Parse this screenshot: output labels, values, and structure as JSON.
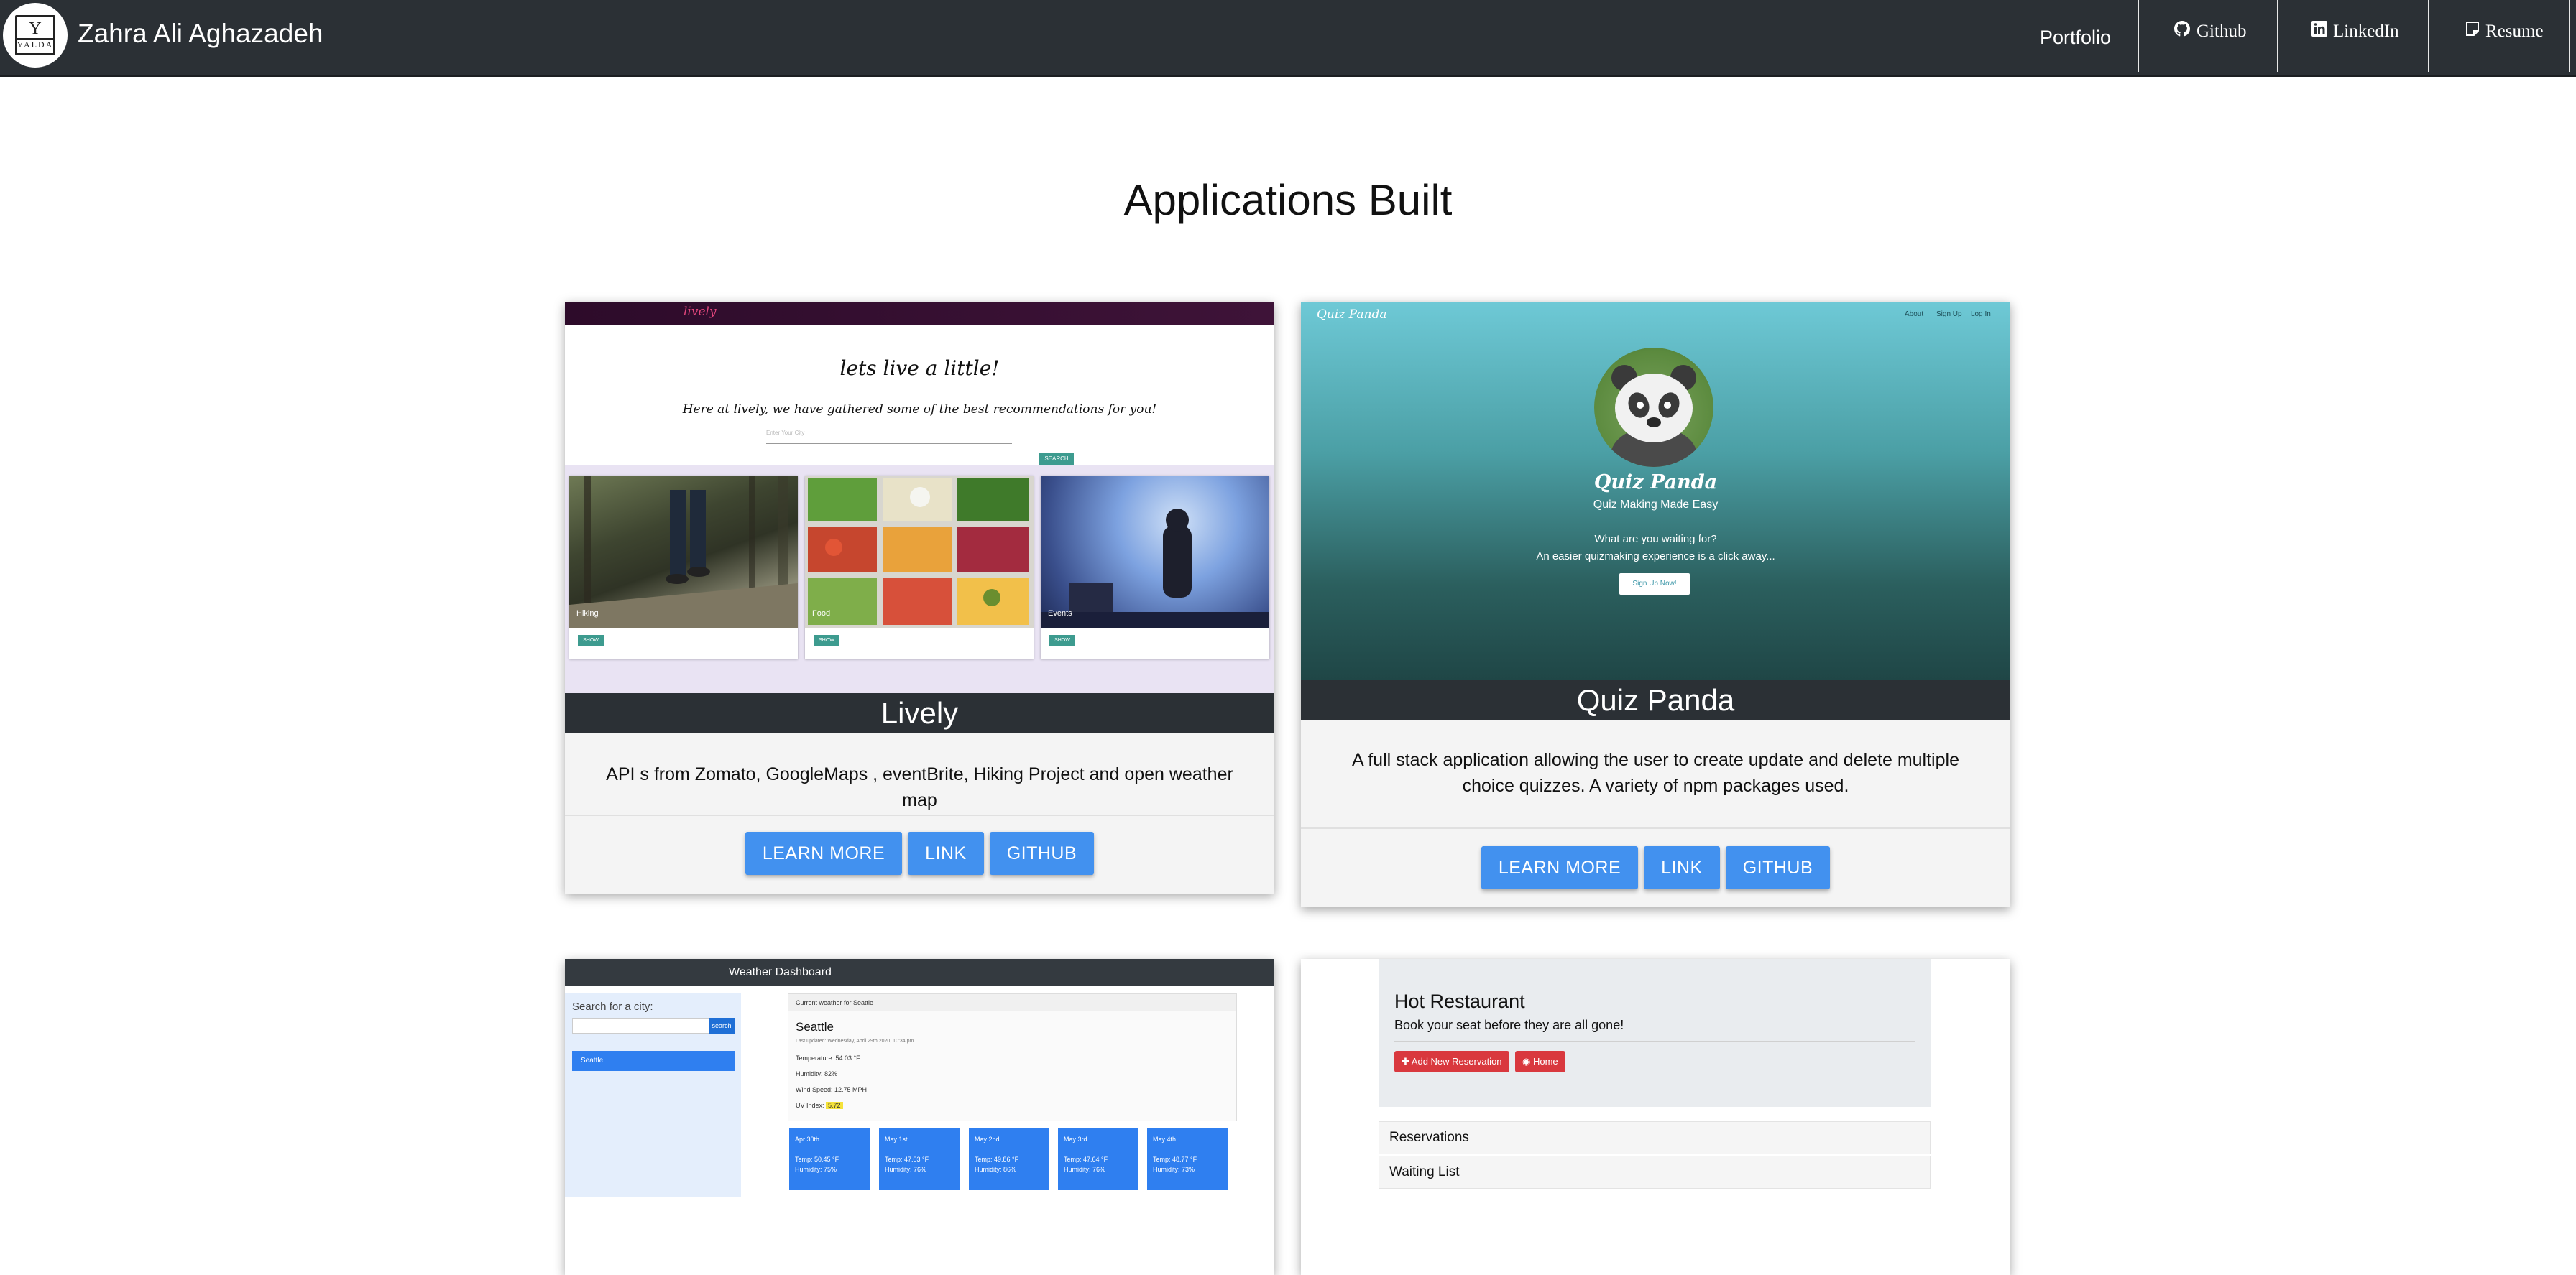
{
  "navbar": {
    "logo_text": "YALDA",
    "logo_letter": "Y",
    "brand_name": "Zahra Ali Aghazadeh",
    "links": {
      "portfolio": "Portfolio",
      "github": "Github",
      "linkedin": "LinkedIn",
      "resume": "Resume"
    },
    "icons": {
      "github": "github-icon",
      "linkedin": "linkedin-icon",
      "resume": "document-icon"
    }
  },
  "main": {
    "title": "Applications Built"
  },
  "projects": [
    {
      "name": "Lively",
      "description": "API s from Zomato, GoogleMaps , eventBrite, Hiking Project and open weather map",
      "buttons": [
        "LEARN MORE",
        "LINK",
        "GITHUB"
      ],
      "preview": {
        "logo": "lively",
        "heading": "lets live a little!",
        "subheading": "Here at lively, we have gathered some of the best recommendations for you!",
        "input_placeholder": "Enter Your City",
        "search_button": "SEARCH",
        "tiles": [
          {
            "label": "Hiking",
            "button": "SHOW"
          },
          {
            "label": "Food",
            "button": "SHOW"
          },
          {
            "label": "Events",
            "button": "SHOW"
          }
        ]
      }
    },
    {
      "name": "Quiz Panda",
      "description": "A full stack application allowing the user to create update and delete multiple choice quizzes. A variety of npm packages used.",
      "buttons": [
        "LEARN MORE",
        "LINK",
        "GITHUB"
      ],
      "preview": {
        "brand": "Quiz Panda",
        "nav": [
          "About",
          "Sign Up",
          "Log In"
        ],
        "title": "Quiz Panda",
        "subtitle": "Quiz Making Made Easy",
        "line1": "What are you waiting for?",
        "line2": "An easier quizmaking experience is a click away...",
        "cta": "Sign Up Now!"
      }
    },
    {
      "name": "Weather Dashboard",
      "preview": {
        "header": "Weather Dashboard",
        "search_label": "Search for a city:",
        "search_button": "search",
        "history": [
          "Seattle"
        ],
        "current_header": "Current weather for Seattle",
        "city": "Seattle",
        "updated": "Last updated: Wednesday, April 29th 2020, 10:34 pm",
        "temperature": "Temperature: 54.03 °F",
        "humidity": "Humidity: 82%",
        "wind": "Wind Speed: 12.75 MPH",
        "uv_label": "UV Index:",
        "uv_value": "5.72",
        "forecast": [
          {
            "date": "Apr 30th",
            "temp": "Temp: 50.45 °F",
            "humidity": "Humidity: 75%"
          },
          {
            "date": "May 1st",
            "temp": "Temp: 47.03 °F",
            "humidity": "Humidity: 76%"
          },
          {
            "date": "May 2nd",
            "temp": "Temp: 49.86 °F",
            "humidity": "Humidity: 86%"
          },
          {
            "date": "May 3rd",
            "temp": "Temp: 47.64 °F",
            "humidity": "Humidity: 76%"
          },
          {
            "date": "May 4th",
            "temp": "Temp: 48.77 °F",
            "humidity": "Humidity: 73%"
          }
        ]
      }
    },
    {
      "name": "Hot Restaurant",
      "preview": {
        "title": "Hot Restaurant",
        "subtitle": "Book your seat before they are all gone!",
        "buttons": [
          "Add New Reservation",
          "Home"
        ],
        "list": [
          "Reservations",
          "Waiting List"
        ]
      }
    }
  ],
  "colors": {
    "navbar_bg": "#2b3035",
    "button_blue": "#4291ef",
    "teal": "#3d9b8f",
    "danger_red": "#d9383e"
  }
}
